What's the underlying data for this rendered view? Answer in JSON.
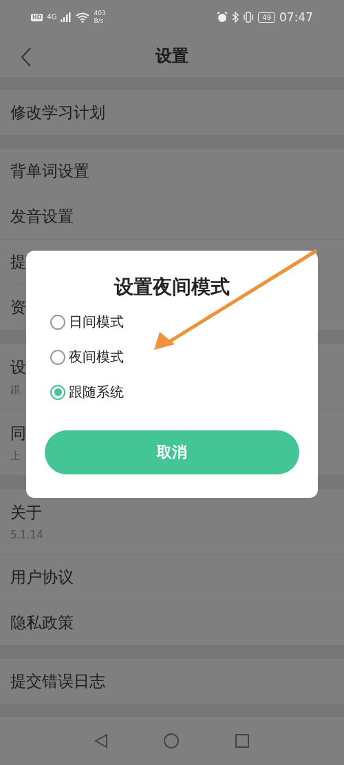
{
  "status_bar": {
    "hd": "HD",
    "network": "4G",
    "speed": "403",
    "speed_unit": "B/s",
    "battery": "49",
    "time": "07:47"
  },
  "header": {
    "title": "设置"
  },
  "groups": [
    {
      "items": [
        {
          "title": "修改学习计划"
        }
      ]
    },
    {
      "items": [
        {
          "title": "背单词设置"
        },
        {
          "title": "发音设置"
        },
        {
          "title": "提"
        },
        {
          "title": "资"
        }
      ]
    },
    {
      "items": [
        {
          "title": "设",
          "subtitle": "跟"
        },
        {
          "title": "同",
          "subtitle": "上"
        }
      ]
    },
    {
      "items": [
        {
          "title": "关于",
          "subtitle": "5.1.14"
        },
        {
          "title": "用户协议"
        },
        {
          "title": "隐私政策"
        }
      ]
    },
    {
      "items": [
        {
          "title": "提交错误日志"
        }
      ]
    }
  ],
  "dialog": {
    "title": "设置夜间模式",
    "options": [
      {
        "label": "日间模式",
        "selected": false
      },
      {
        "label": "夜间模式",
        "selected": false
      },
      {
        "label": "跟随系统",
        "selected": true
      }
    ],
    "button": "取消"
  }
}
